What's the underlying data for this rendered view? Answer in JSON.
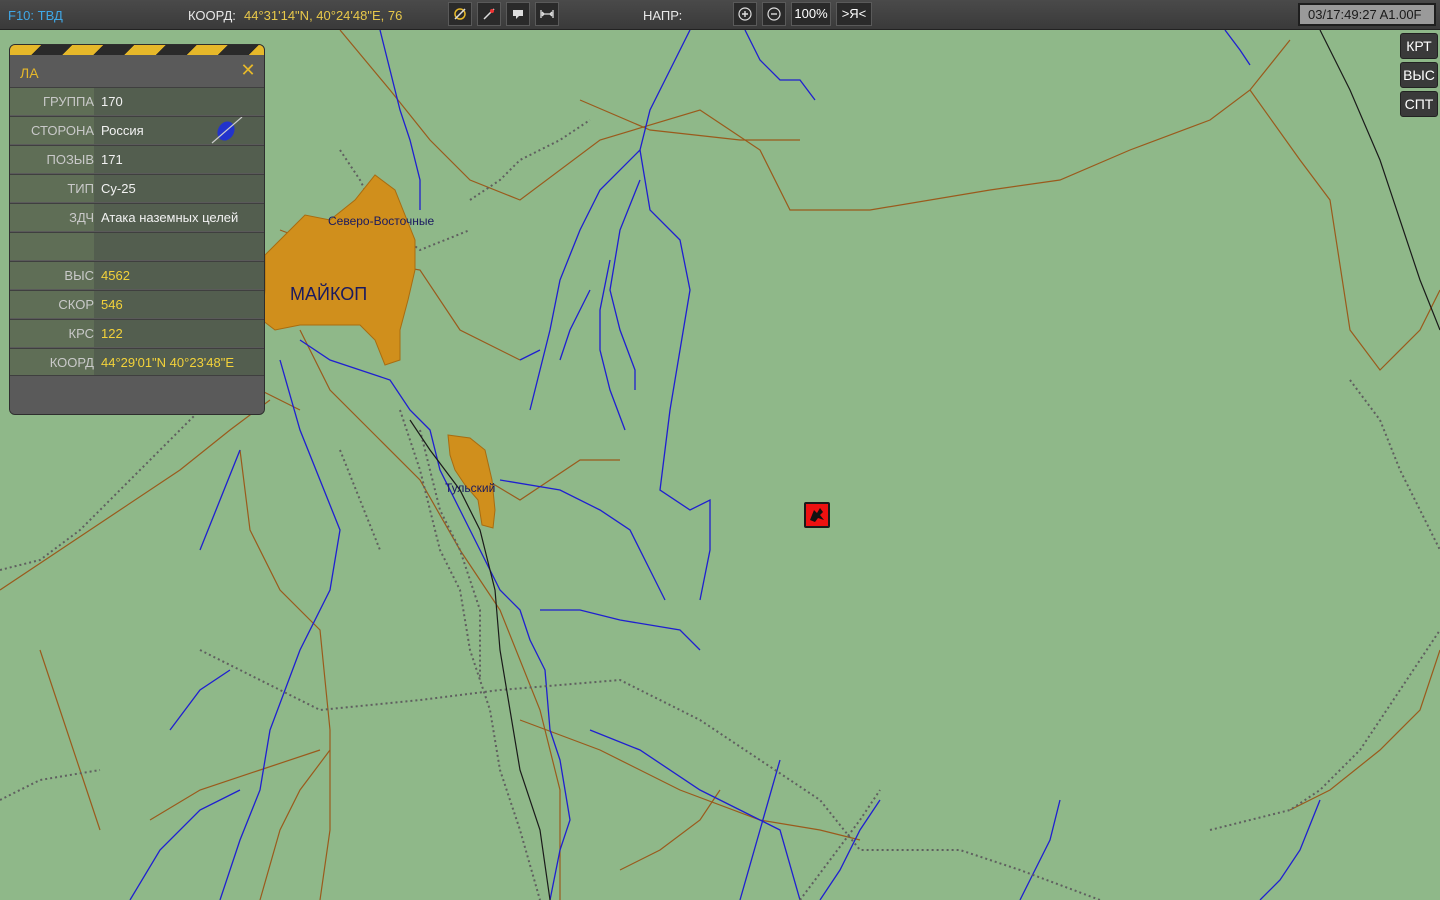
{
  "topbar": {
    "view_label": "F10: ТВД",
    "coord_label": "КООРД:",
    "coord_value": "44°31'14\"N, 40°24'48\"E, 76",
    "heading_label": "НАПР:",
    "zoom_value": "100%",
    "center_self_label": ">Я<",
    "clock": "03/17:49:27 A1.00F"
  },
  "side_buttons": [
    {
      "label": "КРТ"
    },
    {
      "label": "ВЫС"
    },
    {
      "label": "СПТ"
    }
  ],
  "panel": {
    "title": "ЛА",
    "close_symbol": "✕",
    "rows": [
      {
        "label": "ГРУППА",
        "value": "170"
      },
      {
        "label": "СТОРОНА",
        "value": "Россия"
      },
      {
        "label": "ПОЗЫВ",
        "value": "171"
      },
      {
        "label": "ТИП",
        "value": "Су-25"
      },
      {
        "label": "ЗДЧ",
        "value": "Атака наземных целей"
      },
      {
        "label": "",
        "value": ""
      },
      {
        "label": "ВЫС",
        "value": "4562"
      },
      {
        "label": "СКОР",
        "value": "546"
      },
      {
        "label": "КРС",
        "value": "122"
      },
      {
        "label": "КООРД",
        "value": "44°29'01\"N  40°23'48\"E"
      }
    ]
  },
  "map": {
    "city_main": "МАЙКОП",
    "town_ne": "Северо-Восточные",
    "town_tulsky": "Тульский"
  },
  "icons": [
    "bullseye-icon",
    "waypoint-icon",
    "comment-icon",
    "ruler-icon",
    "zoom-in-icon",
    "zoom-out-icon",
    "aircraft-icon",
    "side-flag-icon",
    "close-icon"
  ],
  "colors": {
    "map_bg": "#8fb889",
    "city": "#d08f1c",
    "river": "#1f1fd0",
    "road": "#9a5a1c",
    "rail": "#5a5a5a",
    "accent": "#e6b82a",
    "hostile": "#ee1111"
  }
}
